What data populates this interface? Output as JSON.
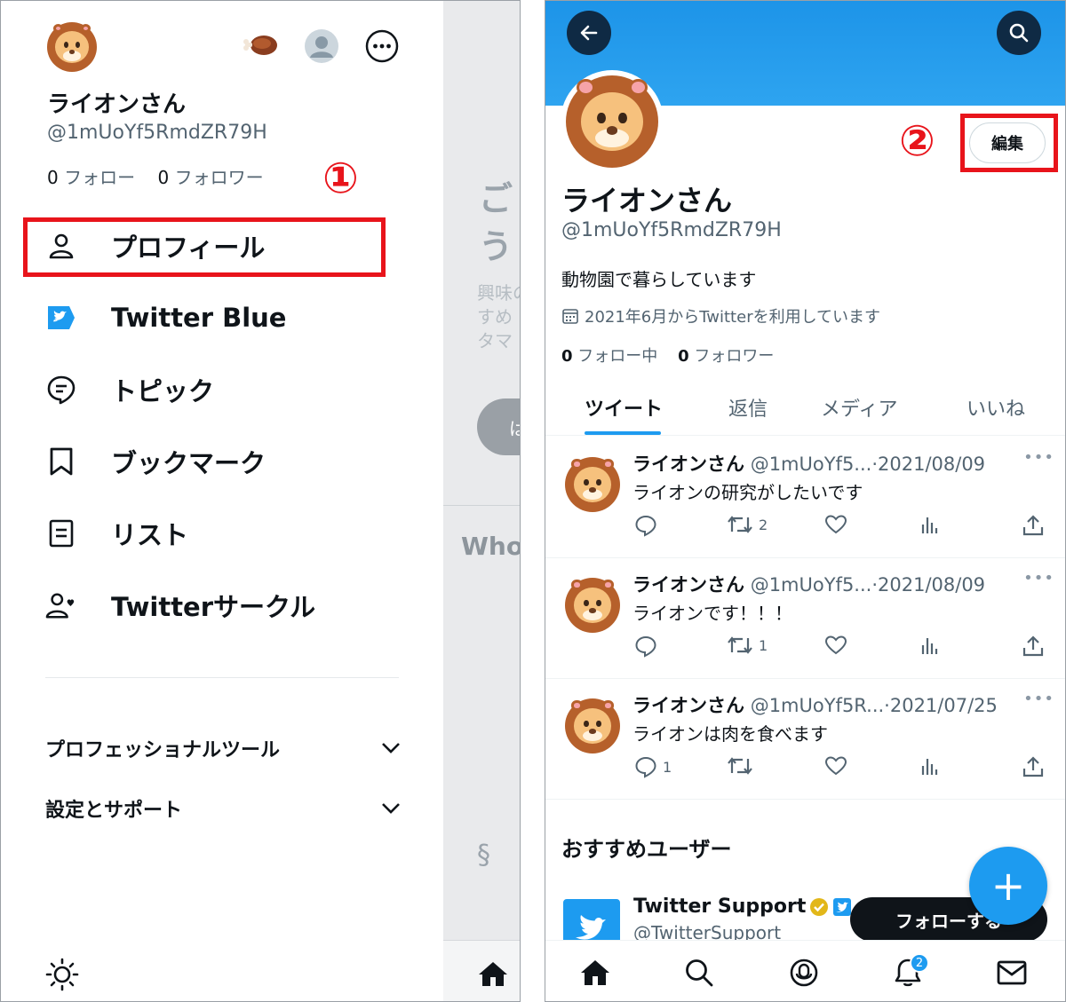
{
  "drawer": {
    "name": "ライオンさん",
    "handle": "@1mUoYf5RmdZR79H",
    "following_count": "0",
    "following_label": "フォロー",
    "followers_count": "0",
    "followers_label": "フォロワー",
    "menu": [
      {
        "label": "プロフィール",
        "icon": "person-icon"
      },
      {
        "label": "Twitter Blue",
        "icon": "twitter-blue-icon"
      },
      {
        "label": "トピック",
        "icon": "topics-icon"
      },
      {
        "label": "ブックマーク",
        "icon": "bookmark-icon"
      },
      {
        "label": "リスト",
        "icon": "list-icon"
      },
      {
        "label": "Twitterサークル",
        "icon": "circle-people-icon"
      }
    ],
    "accordions": [
      {
        "label": "プロフェッショナルツール"
      },
      {
        "label": "設定とサポート"
      }
    ]
  },
  "annotations": {
    "step1": "①",
    "step2": "②"
  },
  "background_timeline": {
    "heading_chars": [
      "ご",
      "う"
    ],
    "text_lines": "興味の\nすめ\nタマ",
    "button_char": "は",
    "who_label": "Who"
  },
  "profile": {
    "name": "ライオンさん",
    "handle": "@1mUoYf5RmdZR79H",
    "bio": "動物園で暮らしています",
    "joined": "2021年6月からTwitterを利用しています",
    "following_count": "0",
    "following_label": "フォロー中",
    "followers_count": "0",
    "followers_label": "フォロワー",
    "edit_label": "編集",
    "tabs": [
      "ツイート",
      "返信",
      "メディア",
      "いいね"
    ],
    "active_tab": "ツイート"
  },
  "tweets": [
    {
      "name": "ライオンさん",
      "handle_date": "@1mUoYf5...·2021/08/09",
      "text": "ライオンの研究がしたいです",
      "replies": "",
      "retweets": "2"
    },
    {
      "name": "ライオンさん",
      "handle_date": "@1mUoYf5...·2021/08/09",
      "text": "ライオンです！！！",
      "replies": "",
      "retweets": "1"
    },
    {
      "name": "ライオンさん",
      "handle_date": "@1mUoYf5R...·2021/07/25",
      "text": "ライオンは肉を食べます",
      "replies": "1",
      "retweets": ""
    }
  ],
  "recommended": {
    "title": "おすすめユーザー",
    "name": "Twitter Support",
    "handle": "@TwitterSupport",
    "follow_label": "フォローする"
  },
  "bottom_nav": {
    "notifications_badge": "2"
  },
  "colors": {
    "accent": "#1d9bf0",
    "annotation_red": "#e8141b",
    "text_primary": "#0f1419",
    "text_secondary": "#536471"
  }
}
